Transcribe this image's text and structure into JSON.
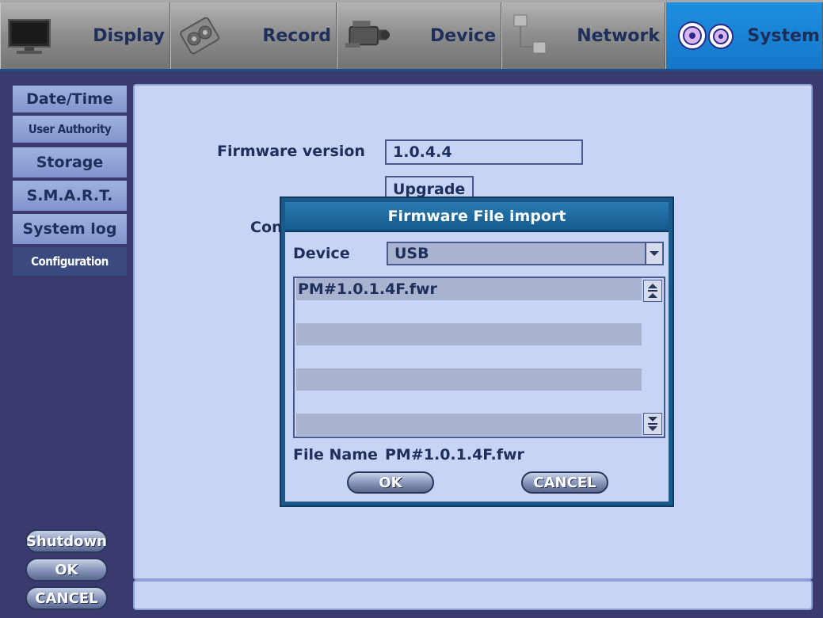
{
  "tabs": [
    {
      "label": "Display",
      "icon": "monitor-icon"
    },
    {
      "label": "Record",
      "icon": "film-reel-icon"
    },
    {
      "label": "Device",
      "icon": "camcorder-icon"
    },
    {
      "label": "Network",
      "icon": "network-icon"
    },
    {
      "label": "System",
      "icon": "gears-icon",
      "active": true
    }
  ],
  "sidebar": {
    "items": [
      {
        "label": "Date/Time"
      },
      {
        "label": "User Authority"
      },
      {
        "label": "Storage"
      },
      {
        "label": "S.M.A.R.T."
      },
      {
        "label": "System log"
      },
      {
        "label": "Configuration",
        "selected": true
      }
    ],
    "shutdown_label": "Shutdown",
    "ok_label": "OK",
    "cancel_label": "CANCEL"
  },
  "main": {
    "firmware_version_label": "Firmware version",
    "firmware_version_value": "1.0.4.4",
    "upgrade_label": "Upgrade",
    "partial_label": "Con"
  },
  "dialog": {
    "title": "Firmware File import",
    "device_label": "Device",
    "device_value": "USB",
    "files": [
      "PM#1.0.1.4F.fwr",
      "",
      "",
      "",
      "",
      ""
    ],
    "file_name_label": "File Name",
    "file_name_value": "PM#1.0.1.4F.fwr",
    "ok_label": "OK",
    "cancel_label": "CANCEL"
  },
  "colors": {
    "accent": "#1577c9",
    "panel": "#c8d4f5",
    "dialog_border": "#1a5a8a",
    "text": "#1d2f5a"
  }
}
